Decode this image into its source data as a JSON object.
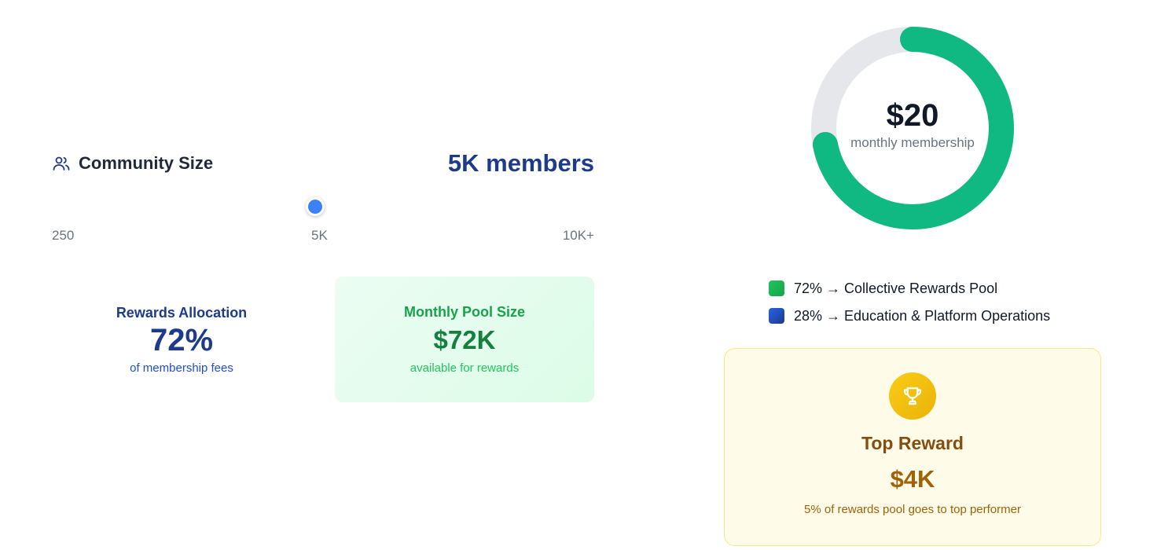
{
  "community": {
    "label": "Community Size",
    "value": "5K members",
    "icon": "users-icon",
    "slider": {
      "min_label": "250",
      "mid_label": "5K",
      "max_label": "10K+",
      "selected": "5K"
    }
  },
  "allocation": {
    "title": "Rewards Allocation",
    "value": "72%",
    "subtitle": "of membership fees"
  },
  "pool": {
    "title": "Monthly Pool Size",
    "value": "$72K",
    "subtitle": "available for rewards"
  },
  "donut": {
    "amount": "$20",
    "label": "monthly membership",
    "colors": {
      "filled": "#10b981",
      "track": "#e5e7eb"
    },
    "filled_percent": 72
  },
  "legend": [
    {
      "text": "72% → Collective Rewards Pool",
      "color": "#22c55e"
    },
    {
      "text": "28% → Education & Platform Operations",
      "color": "#1e40af"
    }
  ],
  "reward": {
    "icon": "trophy-icon",
    "title": "Top Reward",
    "value": "$4K",
    "subtitle": "5% of rewards pool goes to top performer"
  },
  "colors": {
    "accent_blue": "#3b82f6",
    "navy": "#1e3a8a",
    "green": "#16a34a",
    "gold": "#eab308"
  }
}
